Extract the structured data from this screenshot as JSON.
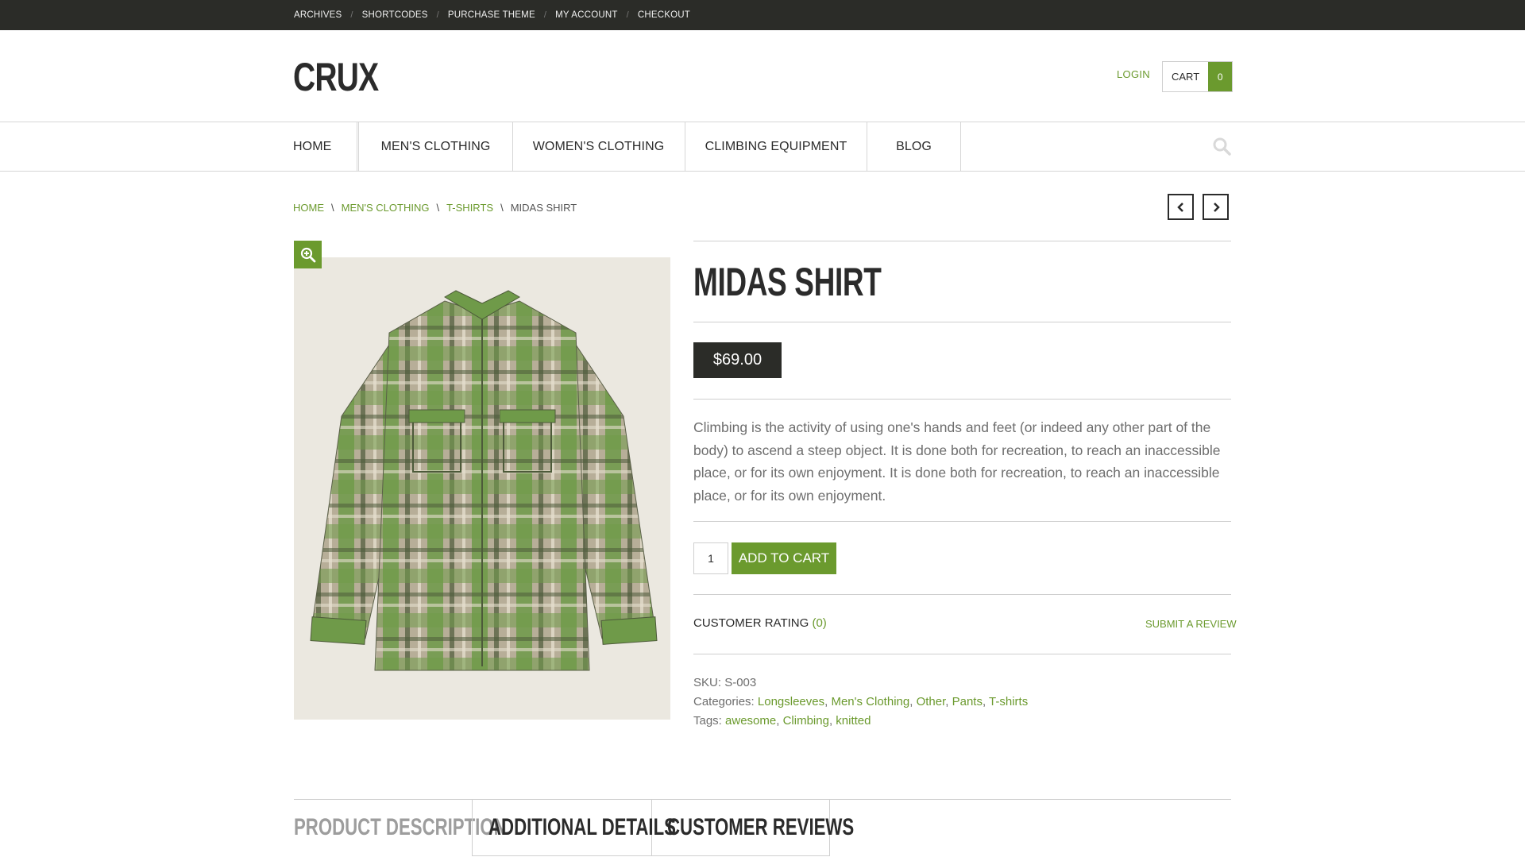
{
  "topbar": {
    "links": [
      "ARCHIVES",
      "SHORTCODES",
      "PURCHASE THEME",
      "MY ACCOUNT",
      "CHECKOUT"
    ],
    "separator": "/"
  },
  "header": {
    "logo": "CRUX",
    "login": "LOGIN",
    "cart_label": "CART",
    "cart_count": "0"
  },
  "nav": {
    "items": [
      "HOME",
      "MEN'S CLOTHING",
      "WOMEN'S CLOTHING",
      "CLIMBING EQUIPMENT",
      "BLOG"
    ]
  },
  "breadcrumb": {
    "items": [
      "HOME",
      "MEN'S CLOTHING",
      "T-SHIRTS"
    ],
    "current": "MIDAS SHIRT",
    "separator": "\\"
  },
  "product": {
    "title": "MIDAS SHIRT",
    "price": "$69.00",
    "description": "Climbing is the activity of using one's hands and feet (or indeed any other part of the body) to ascend a steep object. It is done both for recreation, to reach an inaccessible place, or for its own enjoyment. It is done both for recreation, to reach an inaccessible place, or for its own enjoyment.",
    "quantity": "1",
    "add_to_cart": "ADD TO CART",
    "rating_label": "CUSTOMER RATING",
    "rating_count": "(0)",
    "submit_review": "SUBMIT A REVIEW",
    "sku_label": "SKU:",
    "sku": "S-003",
    "categories_label": "Categories:",
    "categories": [
      "Longsleeves",
      "Men's Clothing",
      "Other",
      "Pants",
      "T-shirts"
    ],
    "tags_label": "Tags:",
    "tags": [
      "awesome",
      "Climbing",
      "knitted"
    ]
  },
  "tabs": {
    "description": "PRODUCT DESCRIPTION",
    "additional": "ADDITIONAL DETAILS",
    "reviews": "CUSTOMER REVIEWS"
  },
  "colors": {
    "accent": "#6b9a2e",
    "dark": "#2b2c28"
  },
  "icons": {
    "search": "search-icon",
    "zoom": "zoom-in-icon",
    "prev": "chevron-left-icon",
    "next": "chevron-right-icon"
  }
}
